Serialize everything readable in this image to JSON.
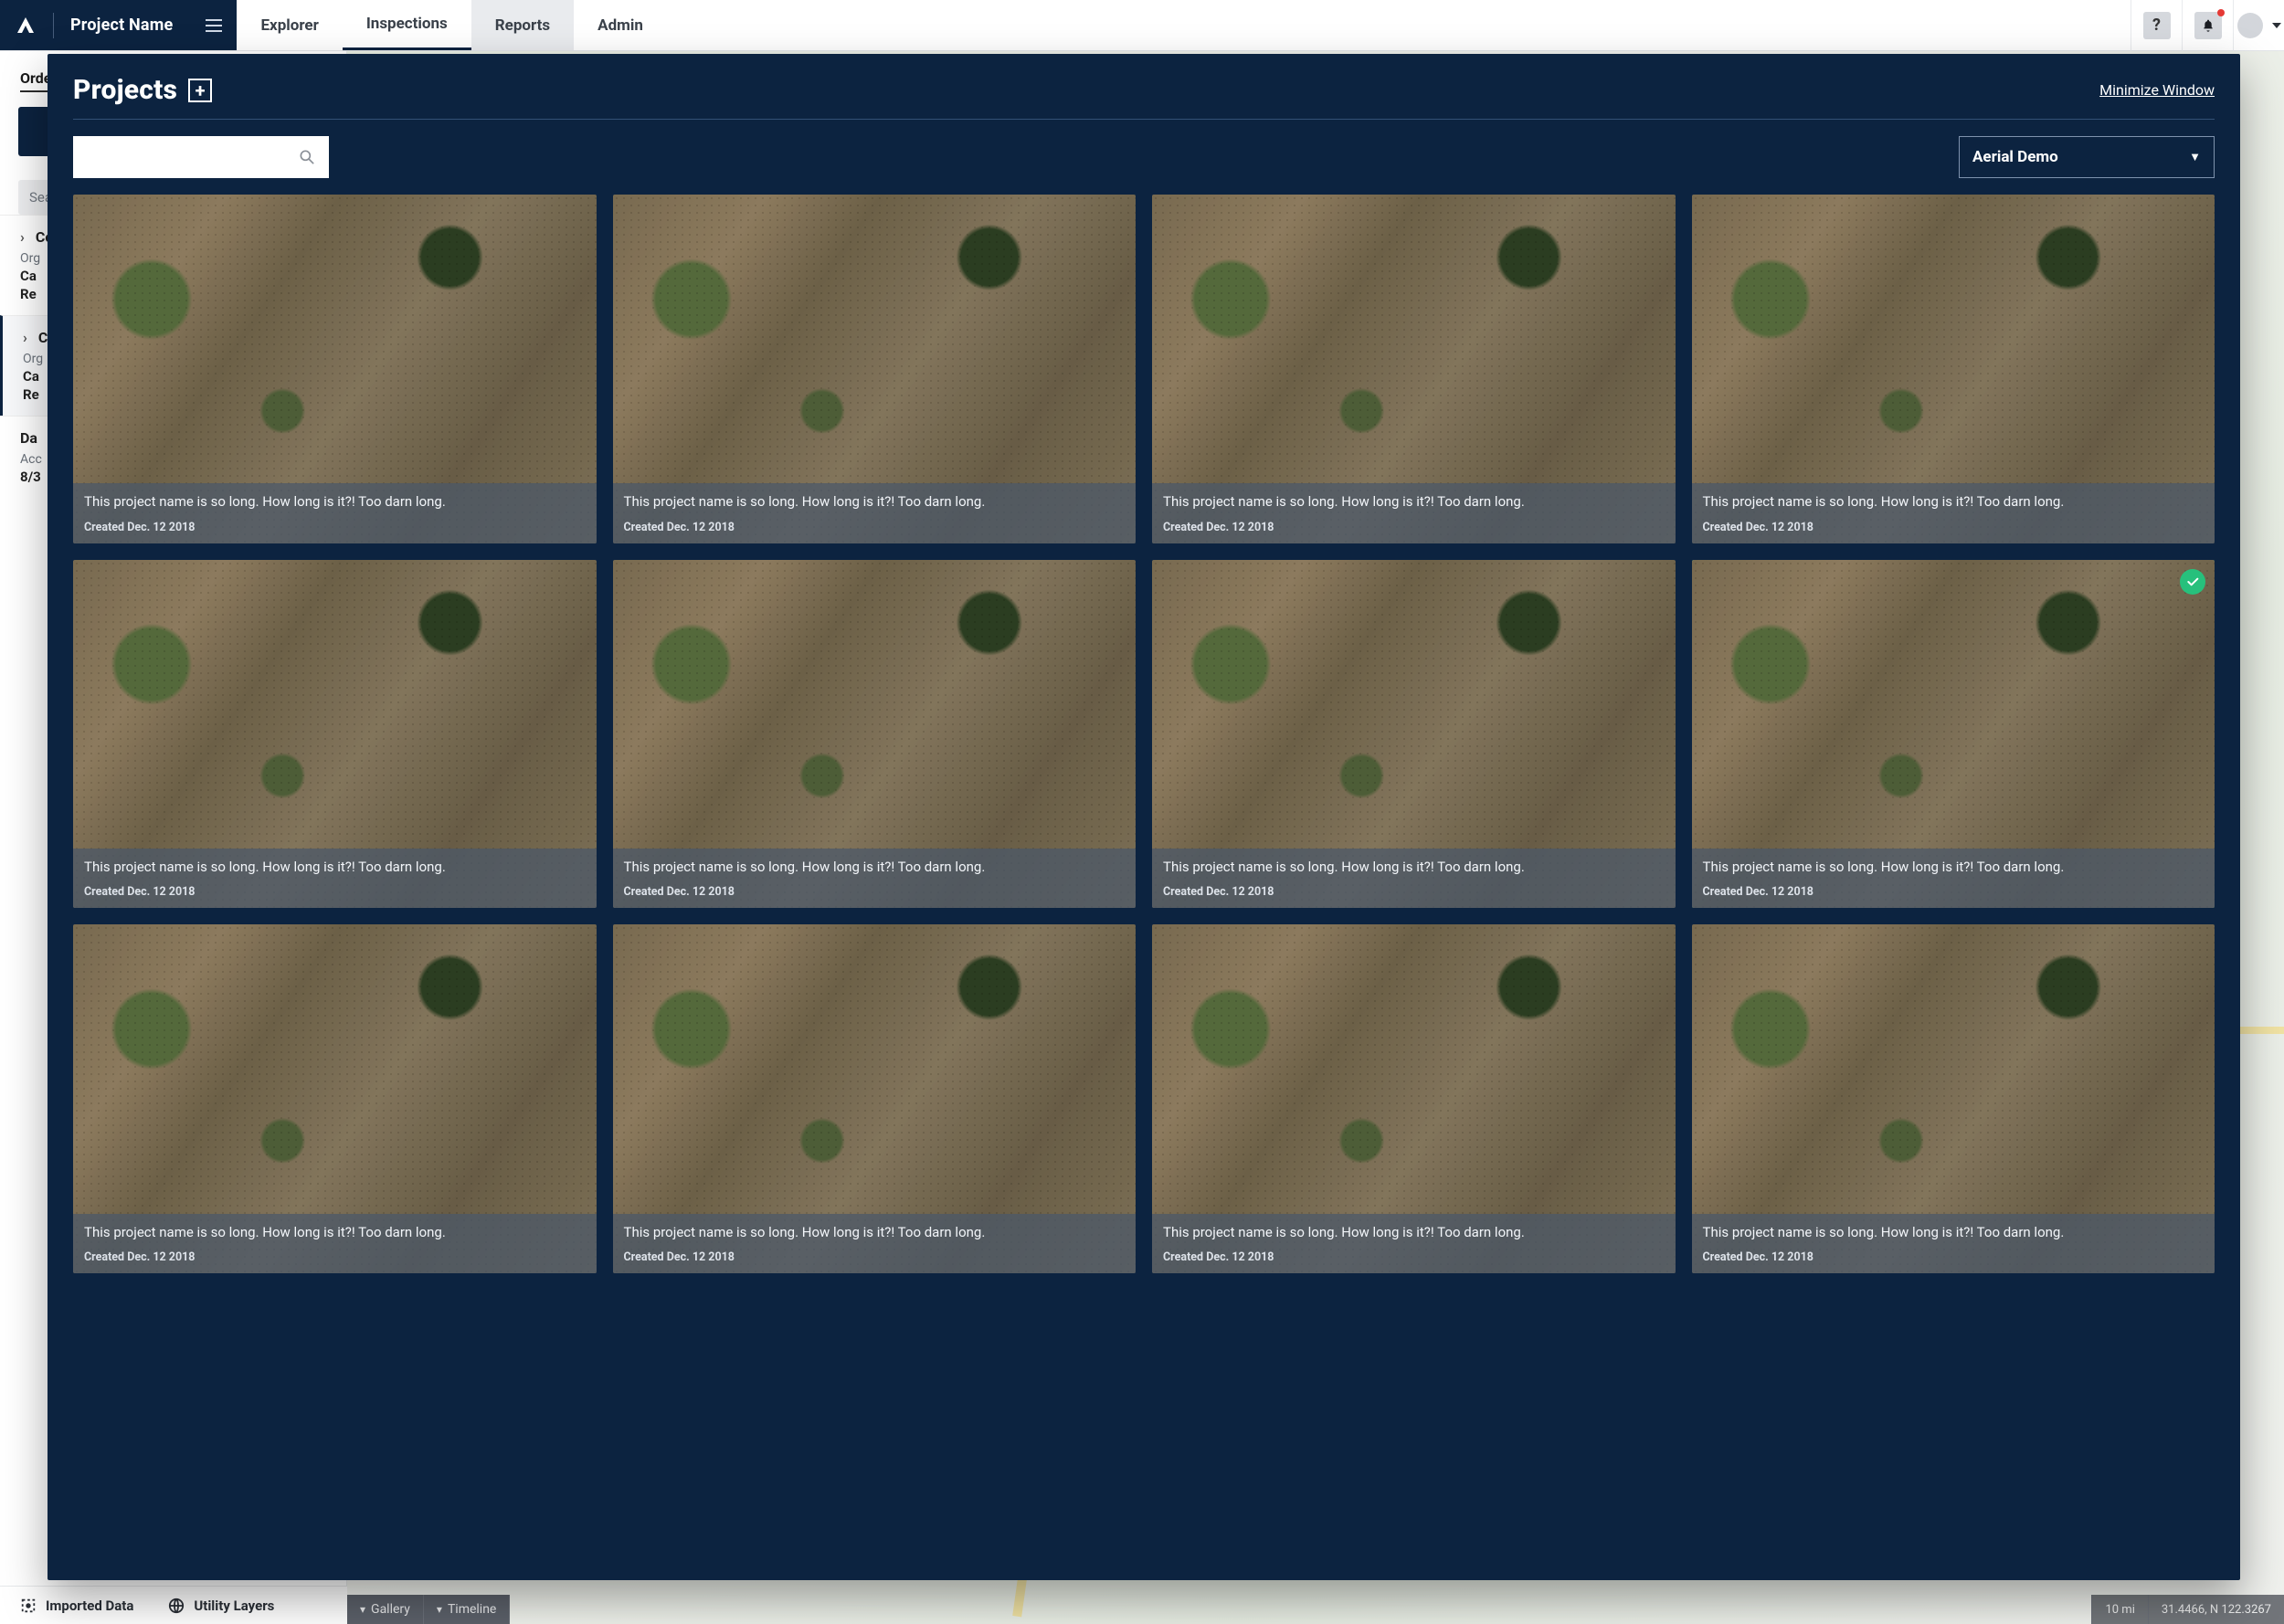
{
  "header": {
    "project_label": "Project Name",
    "tabs": [
      "Explorer",
      "Inspections",
      "Reports",
      "Admin"
    ],
    "active_tab_index": 1,
    "highlight_tab_index": 2,
    "help_label": "?"
  },
  "sidebar": {
    "order_label": "Order",
    "search_placeholder": "Search…",
    "items": [
      {
        "title": "Co…",
        "sub_label": "Org",
        "val1": "Ca",
        "val2": "Re"
      },
      {
        "title": "Co…",
        "sub_label": "Org",
        "val1": "Ca",
        "val2": "Re"
      }
    ],
    "data_block": {
      "title": "Da",
      "sub": "Acc",
      "date": "8/3"
    }
  },
  "footer_left": {
    "imported": "Imported Data",
    "utility": "Utility Layers"
  },
  "footer_bar": {
    "gallery": "Gallery",
    "timeline": "Timeline",
    "scale": "10 mi",
    "coords": "31.4466, N 122.3267"
  },
  "modal": {
    "title": "Projects",
    "minimize": "Minimize Window",
    "search_placeholder": "",
    "dropdown_value": "Aerial Demo"
  },
  "projects": [
    {
      "name": "This project name is so long. How long is it?! Too darn long.",
      "date": "Created Dec. 12 2018",
      "selected": false
    },
    {
      "name": "This project name is so long. How long is it?! Too darn long.",
      "date": "Created Dec. 12 2018",
      "selected": false
    },
    {
      "name": "This project name is so long. How long is it?! Too darn long.",
      "date": "Created Dec. 12 2018",
      "selected": false
    },
    {
      "name": "This project name is so long. How long is it?! Too darn long.",
      "date": "Created Dec. 12 2018",
      "selected": false
    },
    {
      "name": "This project name is so long. How long is it?! Too darn long.",
      "date": "Created Dec. 12 2018",
      "selected": false
    },
    {
      "name": "This project name is so long. How long is it?! Too darn long.",
      "date": "Created Dec. 12 2018",
      "selected": false
    },
    {
      "name": "This project name is so long. How long is it?! Too darn long.",
      "date": "Created Dec. 12 2018",
      "selected": false
    },
    {
      "name": "This project name is so long. How long is it?! Too darn long.",
      "date": "Created Dec. 12 2018",
      "selected": true
    },
    {
      "name": "This project name is so long. How long is it?! Too darn long.",
      "date": "Created Dec. 12 2018",
      "selected": false
    },
    {
      "name": "This project name is so long. How long is it?! Too darn long.",
      "date": "Created Dec. 12 2018",
      "selected": false
    },
    {
      "name": "This project name is so long. How long is it?! Too darn long.",
      "date": "Created Dec. 12 2018",
      "selected": false
    },
    {
      "name": "This project name is so long. How long is it?! Too darn long.",
      "date": "Created Dec. 12 2018",
      "selected": false
    }
  ]
}
